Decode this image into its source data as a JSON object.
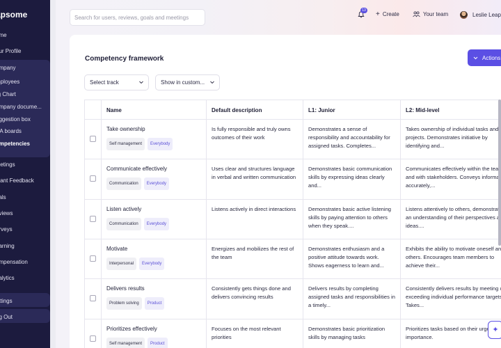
{
  "sidebar": {
    "logo": "apsome",
    "items": [
      {
        "label": "ome"
      },
      {
        "label": "our Profile"
      },
      {
        "label": "ompany"
      },
      {
        "label": "mployees"
      },
      {
        "label": "rg Chart"
      },
      {
        "label": "ompany docume..."
      },
      {
        "label": "uggestion box"
      },
      {
        "label": "&A boards"
      },
      {
        "label": "ompetencies"
      },
      {
        "label": "leetings"
      },
      {
        "label": "stant Feedback"
      },
      {
        "label": "oals"
      },
      {
        "label": "eviews"
      },
      {
        "label": "urveys"
      },
      {
        "label": "earning"
      },
      {
        "label": "ompensation"
      },
      {
        "label": "nalytics"
      },
      {
        "label": "ettings"
      },
      {
        "label": "og Out"
      }
    ]
  },
  "topbar": {
    "search_placeholder": "Search for users, reviews, goals and meetings",
    "notification_count": "13",
    "create_label": "Create",
    "team_label": "Your team",
    "user_name": "Leslie Leaps"
  },
  "page": {
    "title": "Competency framework",
    "actions_label": "Actions",
    "select_track": "Select track",
    "show_in": "Show in custom..."
  },
  "table": {
    "headers": [
      "Name",
      "Default description",
      "L1: Junior",
      "L2: Mid-level"
    ],
    "rows": [
      {
        "name": "Take ownership",
        "tags": [
          "Self management",
          "Everybody"
        ],
        "description": "Is fully responsible and truly owns outcomes of their work",
        "l1": "Demonstrates a sense of responsibility and accountability for assigned tasks. Completes...",
        "l2": "Takes ownership of individual tasks and projects. Demonstrates initiative by identifying and..."
      },
      {
        "name": "Communicate effectively",
        "tags": [
          "Communication",
          "Everybody"
        ],
        "description": "Uses clear and structures language in verbal and written communication",
        "l1": "Demonstrates basic communication skills by expressing ideas clearly and...",
        "l2": "Communicates effectively within the team and with stakeholders. Conveys information accurately,..."
      },
      {
        "name": "Listen actively",
        "tags": [
          "Communication",
          "Everybody"
        ],
        "description": "Listens actively in direct interactions",
        "l1": "Demonstrates basic active listening skills by paying attention to others when they speak....",
        "l2": "Listens attentively to others, demonstrating an understanding of their perspectives and ideas...."
      },
      {
        "name": "Motivate",
        "tags": [
          "Interpersonal",
          "Everybody"
        ],
        "description": "Energizes and mobilizes the rest of the team",
        "l1": "Demonstrates enthusiasm and a positive attitude towards work. Shows eagerness to learn and...",
        "l2": "Exhibits the ability to motivate oneself and others. Encourages team members to achieve their..."
      },
      {
        "name": "Delivers results",
        "tags": [
          "Problem solving",
          "Product"
        ],
        "description": "Consistently gets things done and delivers convincing results",
        "l1": "Delivers results by completing assigned tasks and responsibilities in a timely...",
        "l2": "Consistently delivers results by meeting or exceeding individual performance targets. Takes..."
      },
      {
        "name": "Prioritizes effectively",
        "tags": [
          "Self management",
          "Product"
        ],
        "description": "Focuses on the most relevant priorities",
        "l1": "Demonstrates basic prioritization skills by managing tasks",
        "l2": "Prioritizes tasks based on their urgency and importance."
      }
    ]
  },
  "colors": {
    "accent": "#5b4fe4",
    "sidebar": "#1c1b3e",
    "tag_purple": "#5b50d6"
  },
  "icons": {
    "bell": "bell-icon",
    "plus": "plus-icon",
    "team": "team-icon",
    "chevron": "chevron-down-icon",
    "sparkle": "sparkle-icon"
  }
}
